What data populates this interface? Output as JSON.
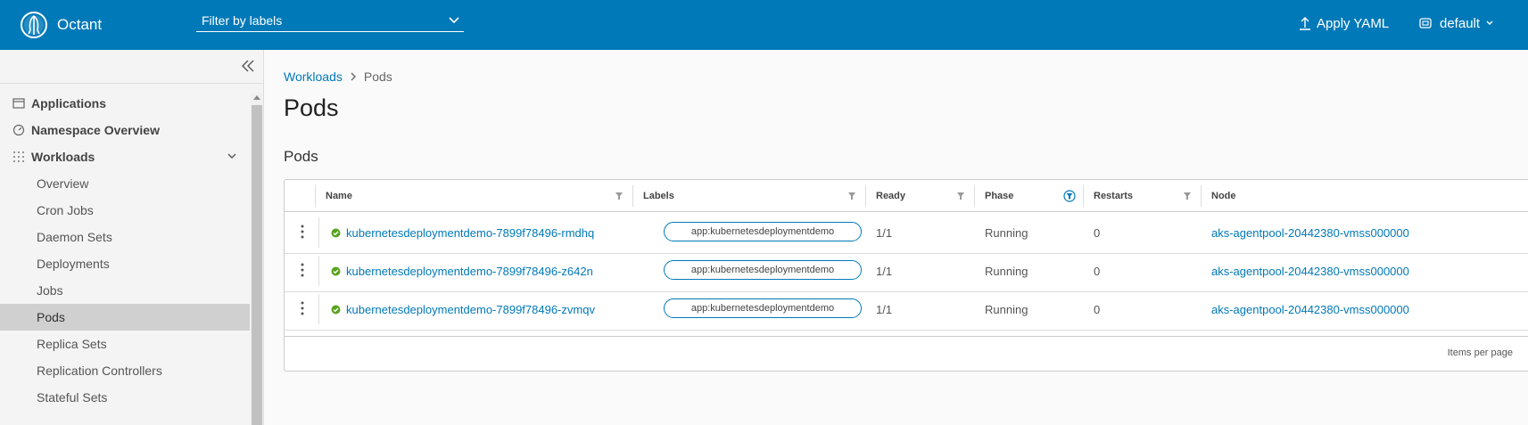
{
  "app": {
    "name": "Octant"
  },
  "header": {
    "filter_placeholder": "Filter by labels",
    "apply_yaml": "Apply YAML",
    "namespace": "default"
  },
  "sidebar": {
    "sections": [
      {
        "label": "Applications",
        "icon": "window-icon"
      },
      {
        "label": "Namespace Overview",
        "icon": "dashboard-icon"
      },
      {
        "label": "Workloads",
        "icon": "grid-dots-icon"
      }
    ],
    "items": [
      {
        "label": "Overview"
      },
      {
        "label": "Cron Jobs"
      },
      {
        "label": "Daemon Sets"
      },
      {
        "label": "Deployments"
      },
      {
        "label": "Jobs"
      },
      {
        "label": "Pods",
        "active": true
      },
      {
        "label": "Replica Sets"
      },
      {
        "label": "Replication Controllers"
      },
      {
        "label": "Stateful Sets"
      }
    ]
  },
  "breadcrumb": {
    "parent": "Workloads",
    "current": "Pods"
  },
  "page_title": "Pods",
  "section_title": "Pods",
  "table": {
    "columns": [
      "Name",
      "Labels",
      "Ready",
      "Phase",
      "Restarts",
      "Node"
    ],
    "rows": [
      {
        "name": "kubernetesdeploymentdemo-7899f78496-rmdhq",
        "label": "app:kubernetesdeploymentdemo",
        "ready": "1/1",
        "phase": "Running",
        "restarts": "0",
        "node": "aks-agentpool-20442380-vmss000000"
      },
      {
        "name": "kubernetesdeploymentdemo-7899f78496-z642n",
        "label": "app:kubernetesdeploymentdemo",
        "ready": "1/1",
        "phase": "Running",
        "restarts": "0",
        "node": "aks-agentpool-20442380-vmss000000"
      },
      {
        "name": "kubernetesdeploymentdemo-7899f78496-zvmqv",
        "label": "app:kubernetesdeploymentdemo",
        "ready": "1/1",
        "phase": "Running",
        "restarts": "0",
        "node": "aks-agentpool-20442380-vmss000000"
      }
    ],
    "footer": "Items per page"
  },
  "colors": {
    "brand": "#0079b8",
    "ok": "#5aa220",
    "active_nav": "#d0d0d0"
  }
}
